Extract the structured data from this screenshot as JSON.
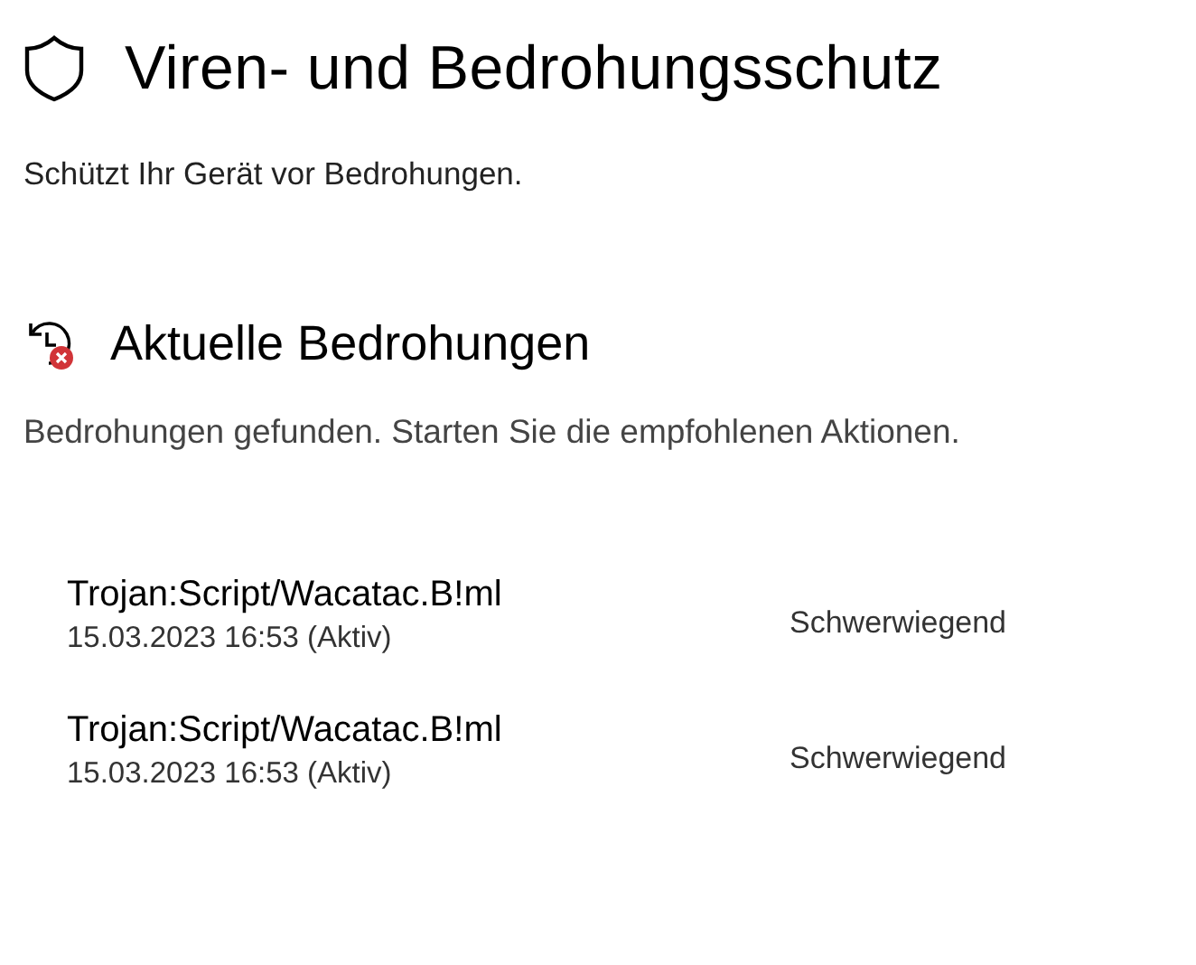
{
  "page": {
    "title": "Viren- und Bedrohungsschutz",
    "subtitle": "Schützt Ihr Gerät vor Bedrohungen."
  },
  "section": {
    "title": "Aktuelle Bedrohungen",
    "description": "Bedrohungen gefunden. Starten Sie die empfohlenen Aktionen."
  },
  "threats": [
    {
      "name": "Trojan:Script/Wacatac.B!ml",
      "date": "15.03.2023 16:53 (Aktiv)",
      "severity": "Schwerwiegend"
    },
    {
      "name": "Trojan:Script/Wacatac.B!ml",
      "date": "15.03.2023 16:53 (Aktiv)",
      "severity": "Schwerwiegend"
    }
  ]
}
